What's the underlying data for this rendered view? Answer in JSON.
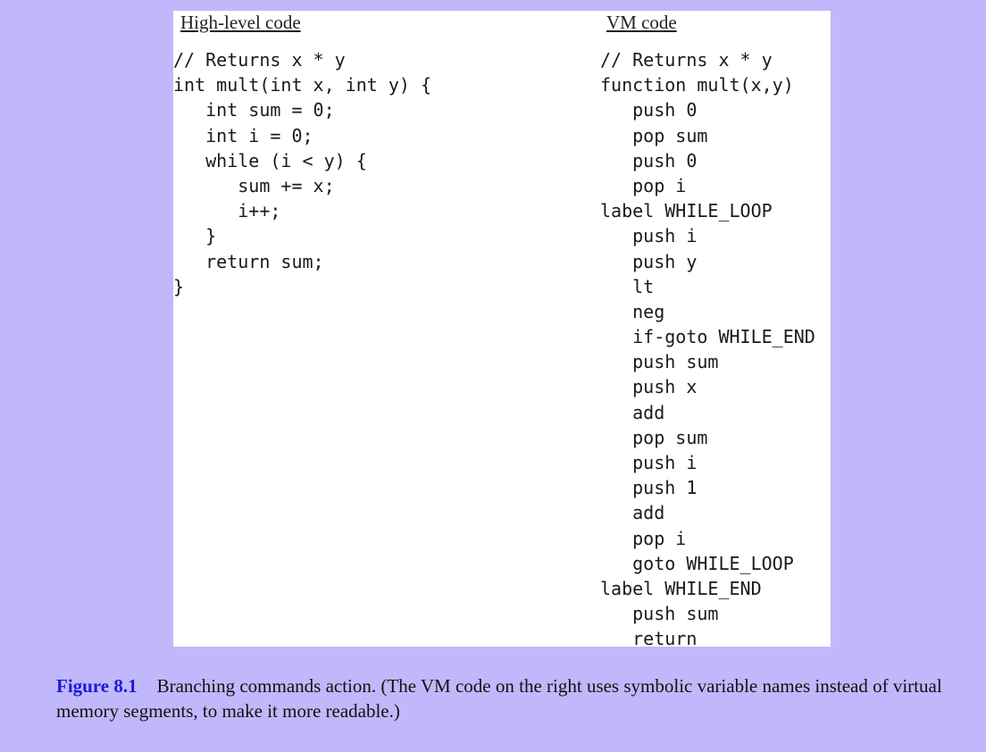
{
  "figure": {
    "left_heading": "High-level code",
    "right_heading": "VM code",
    "left_code": [
      "// Returns x * y",
      "int mult(int x, int y) {",
      "   int sum = 0;",
      "   int i = 0;",
      "   while (i < y) {",
      "      sum += x;",
      "      i++;",
      "   }",
      "   return sum;",
      "}"
    ],
    "right_code": [
      "// Returns x * y",
      "function mult(x,y)",
      "   push 0",
      "   pop sum",
      "   push 0",
      "   pop i",
      "label WHILE_LOOP",
      "   push i",
      "   push y",
      "   lt",
      "   neg",
      "   if-goto WHILE_END",
      "   push sum",
      "   push x",
      "   add",
      "   pop sum",
      "   push i",
      "   push 1",
      "   add",
      "   pop i",
      "   goto WHILE_LOOP",
      "label WHILE_END",
      "   push sum",
      "   return"
    ]
  },
  "caption": {
    "label": "Figure 8.1",
    "text": "Branching commands action. (The VM code on the right uses symbolic variable names instead of virtual memory segments, to make it more readable.)"
  },
  "colors": {
    "background": "#c0b8fa",
    "panel": "#ffffff",
    "caption_label": "#1a1ad8"
  }
}
